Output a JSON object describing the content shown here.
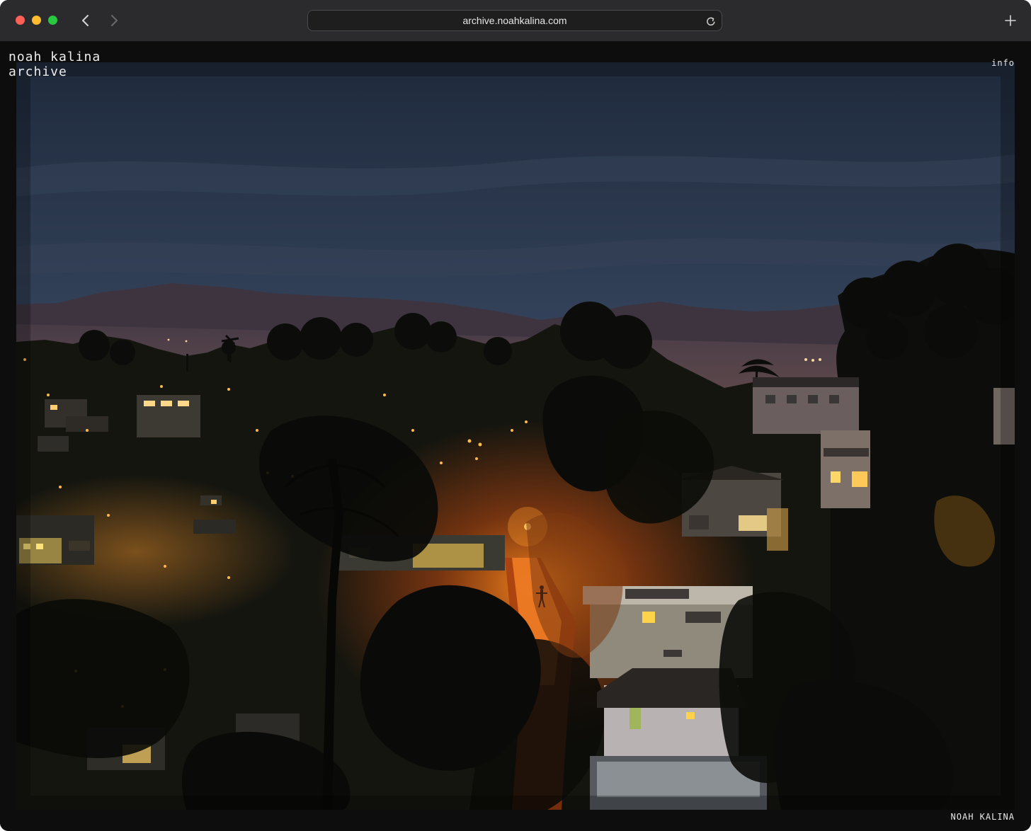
{
  "browser": {
    "url": "archive.noahkalina.com"
  },
  "site": {
    "brand_line1": "noah kalina",
    "brand_line2": "archive",
    "info_link": "info",
    "credit": "NOAH KALINA"
  },
  "photo": {
    "subject": "night-hillside-neighborhood-photo"
  },
  "colors": {
    "window_bg": "#0d0d0d",
    "titlebar": "#2b2b2d",
    "text": "#ececec",
    "traffic_red": "#fe5f57",
    "traffic_yellow": "#febc2e",
    "traffic_green": "#28c840"
  },
  "icons": {
    "back": "chevron-left-icon",
    "forward": "chevron-right-icon",
    "reload": "reload-icon",
    "new_tab": "plus-icon"
  }
}
